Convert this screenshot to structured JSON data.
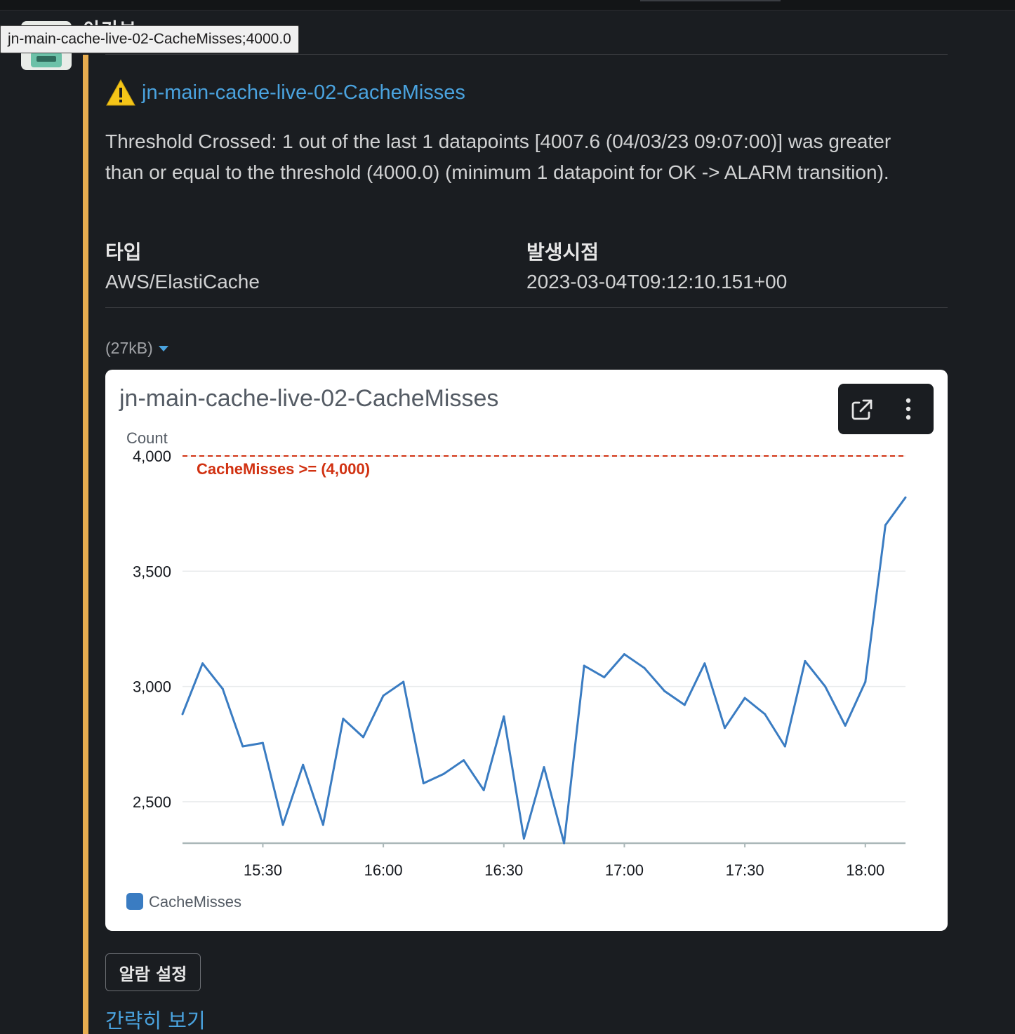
{
  "tooltip": "jn-main-cache-live-02-CacheMisses;4000.0",
  "sender": {
    "name_partial": "이기보"
  },
  "alarm": {
    "title": "jn-main-cache-live-02-CacheMisses",
    "message": "Threshold Crossed: 1 out of the last 1 datapoints [4007.6 (04/03/23 09:07:00)] was greater than or equal to the threshold (4000.0) (minimum 1 datapoint for OK -> ALARM transition).",
    "fields": [
      {
        "label": "타입",
        "value": "AWS/ElastiCache"
      },
      {
        "label": "발생시점",
        "value": "2023-03-04T09:12:10.151+00"
      }
    ]
  },
  "attachment": {
    "size": "(27kB)"
  },
  "chart_data": {
    "type": "line",
    "title": "jn-main-cache-live-02-CacheMisses",
    "ylabel": "Count",
    "ylim": [
      2320,
      4070
    ],
    "yticks": [
      2500,
      3000,
      3500,
      4000
    ],
    "ytick_labels": [
      "2,500",
      "3,000",
      "3,500",
      "4,000"
    ],
    "xlim": [
      "15:10",
      "18:10"
    ],
    "xticks": [
      "15:30",
      "16:00",
      "16:30",
      "17:00",
      "17:30",
      "18:00"
    ],
    "threshold": {
      "value": 4000,
      "label": "CacheMisses >= (4,000)",
      "color": "#d13212"
    },
    "series": [
      {
        "name": "CacheMisses",
        "color": "#3a7cc2",
        "x": [
          "15:10",
          "15:15",
          "15:20",
          "15:25",
          "15:30",
          "15:35",
          "15:40",
          "15:45",
          "15:50",
          "15:55",
          "16:00",
          "16:05",
          "16:10",
          "16:15",
          "16:20",
          "16:25",
          "16:30",
          "16:35",
          "16:40",
          "16:45",
          "16:50",
          "16:55",
          "17:00",
          "17:05",
          "17:10",
          "17:15",
          "17:20",
          "17:25",
          "17:30",
          "17:35",
          "17:40",
          "17:45",
          "17:50",
          "17:55",
          "18:00",
          "18:05",
          "18:10"
        ],
        "values": [
          2880,
          3100,
          2990,
          2740,
          2755,
          2400,
          2660,
          2400,
          2860,
          2780,
          2960,
          3020,
          2580,
          2620,
          2680,
          2550,
          2870,
          2340,
          2650,
          2320,
          3090,
          3040,
          3140,
          3080,
          2980,
          2920,
          3100,
          2820,
          2950,
          2880,
          2740,
          3110,
          3000,
          2830,
          3020,
          3700,
          3820
        ]
      }
    ],
    "legend": "bottom-left",
    "grid": true
  },
  "actions": {
    "alarm_settings": "알람 설정",
    "collapse": "간략히 보기"
  },
  "icons": {
    "warning": "warning-icon",
    "open_external": "external-link-icon",
    "more": "more-vertical-icon",
    "caret": "caret-down-icon"
  }
}
